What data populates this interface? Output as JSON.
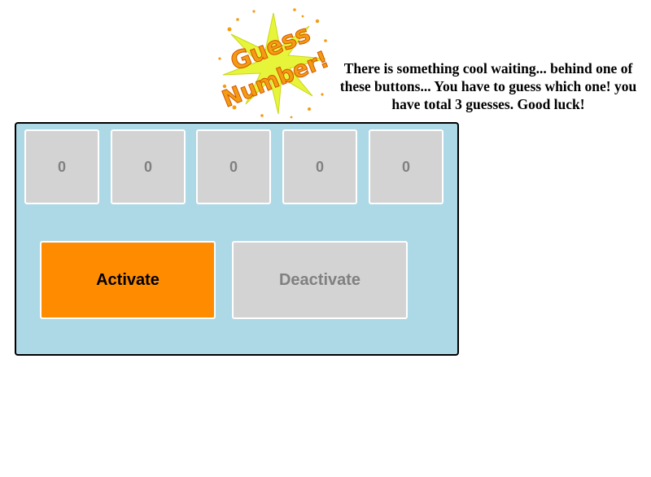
{
  "logo": {
    "icon": "guess-number-logo",
    "text_line1": "Guess",
    "text_line2": "Number!",
    "colors": {
      "text": "#f39c12",
      "burst": "#e6f53a",
      "sparks": "#f39c12"
    }
  },
  "instructions": "There is something cool waiting... behind one of these buttons... You have to guess which one! you have total 3 guesses. Good luck!",
  "board": {
    "background": "#add8e6",
    "guess_buttons": [
      "0",
      "0",
      "0",
      "0",
      "0"
    ]
  },
  "controls": {
    "activate_label": "Activate",
    "deactivate_label": "Deactivate",
    "activate_color": "#ff8c00",
    "deactivate_color": "#d3d3d3"
  }
}
